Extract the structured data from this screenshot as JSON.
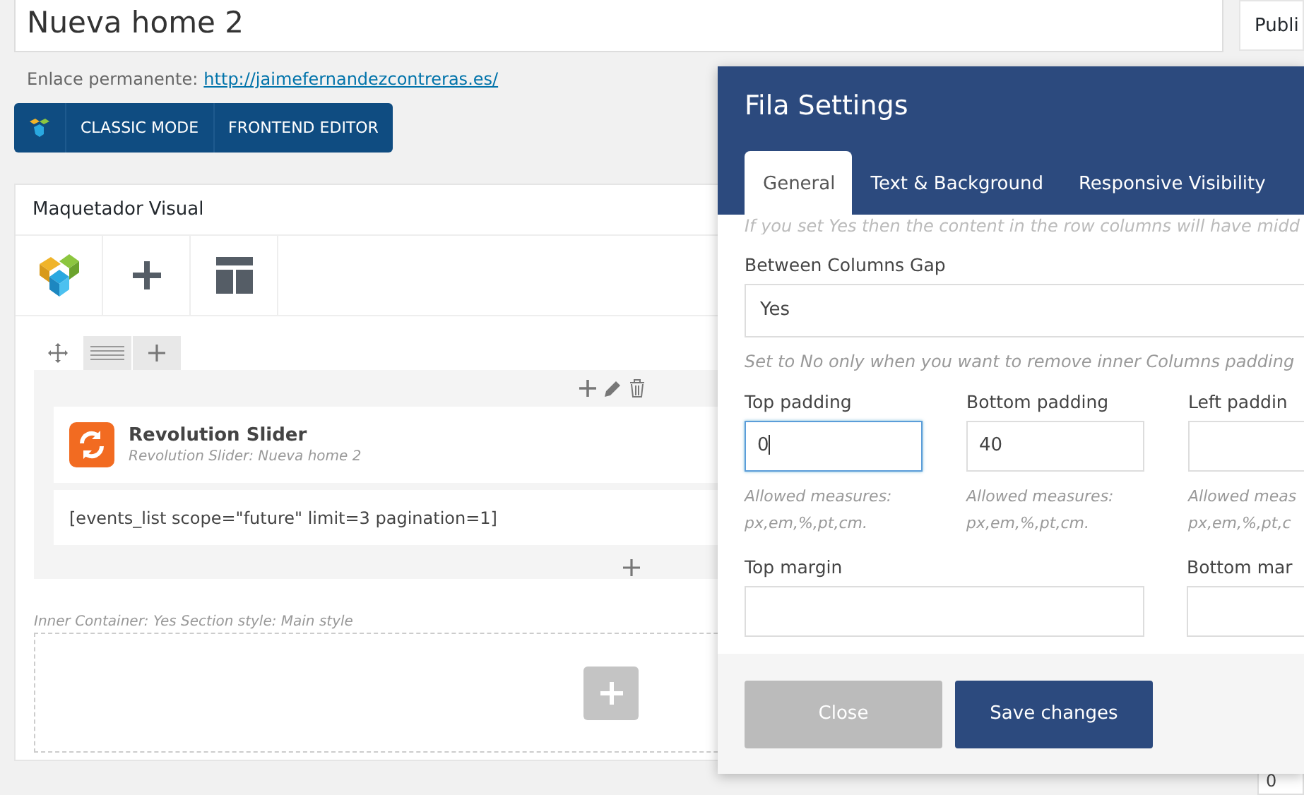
{
  "post_title": {
    "value": "Nueva home 2"
  },
  "permalink": {
    "label": "Enlace permanente:",
    "url": "http://jaimefernandezcontreras.es/"
  },
  "editor_buttons": [
    "CLASSIC MODE",
    "FRONTEND EDITOR"
  ],
  "builder": {
    "title": "Maquetador Visual",
    "elements": [
      {
        "kind": "slider",
        "title": "Revolution Slider",
        "subtitle": "Revolution Slider: Nueva home 2"
      },
      {
        "kind": "shortcode",
        "text": "[events_list scope=\"future\" limit=3 pagination=1]"
      }
    ],
    "section_caption": "Inner Container: Yes  Section style: Main style"
  },
  "sidebar": {
    "title": "Publi",
    "value": "0"
  },
  "modal": {
    "title": "Fila Settings",
    "tabs": [
      {
        "label": "General",
        "selected": true
      },
      {
        "label": "Text & Background",
        "selected": false
      },
      {
        "label": "Responsive Visibility",
        "selected": false
      }
    ],
    "cut_hint": "If you set Yes then the content in the row columns will have midd",
    "gap": {
      "label": "Between Columns Gap",
      "value": "Yes",
      "hint": "Set to No only when you want to remove inner Columns padding"
    },
    "paddings": [
      {
        "label": "Top padding",
        "value": "0",
        "focused": true,
        "hint_lines": [
          "Allowed measures:",
          "px,em,%,pt,cm."
        ]
      },
      {
        "label": "Bottom padding",
        "value": "40",
        "focused": false,
        "hint_lines": [
          "Allowed measures:",
          "px,em,%,pt,cm."
        ]
      },
      {
        "label": "Left paddin",
        "focused": false,
        "hint_lines": [
          "Allowed meas",
          "px,em,%,pt,c"
        ]
      }
    ],
    "margins": [
      {
        "label": "Top margin"
      },
      {
        "label": "Bottom mar"
      }
    ],
    "buttons": [
      {
        "label": "Close",
        "kind": "secondary"
      },
      {
        "label": "Save changes",
        "kind": "primary"
      }
    ]
  }
}
